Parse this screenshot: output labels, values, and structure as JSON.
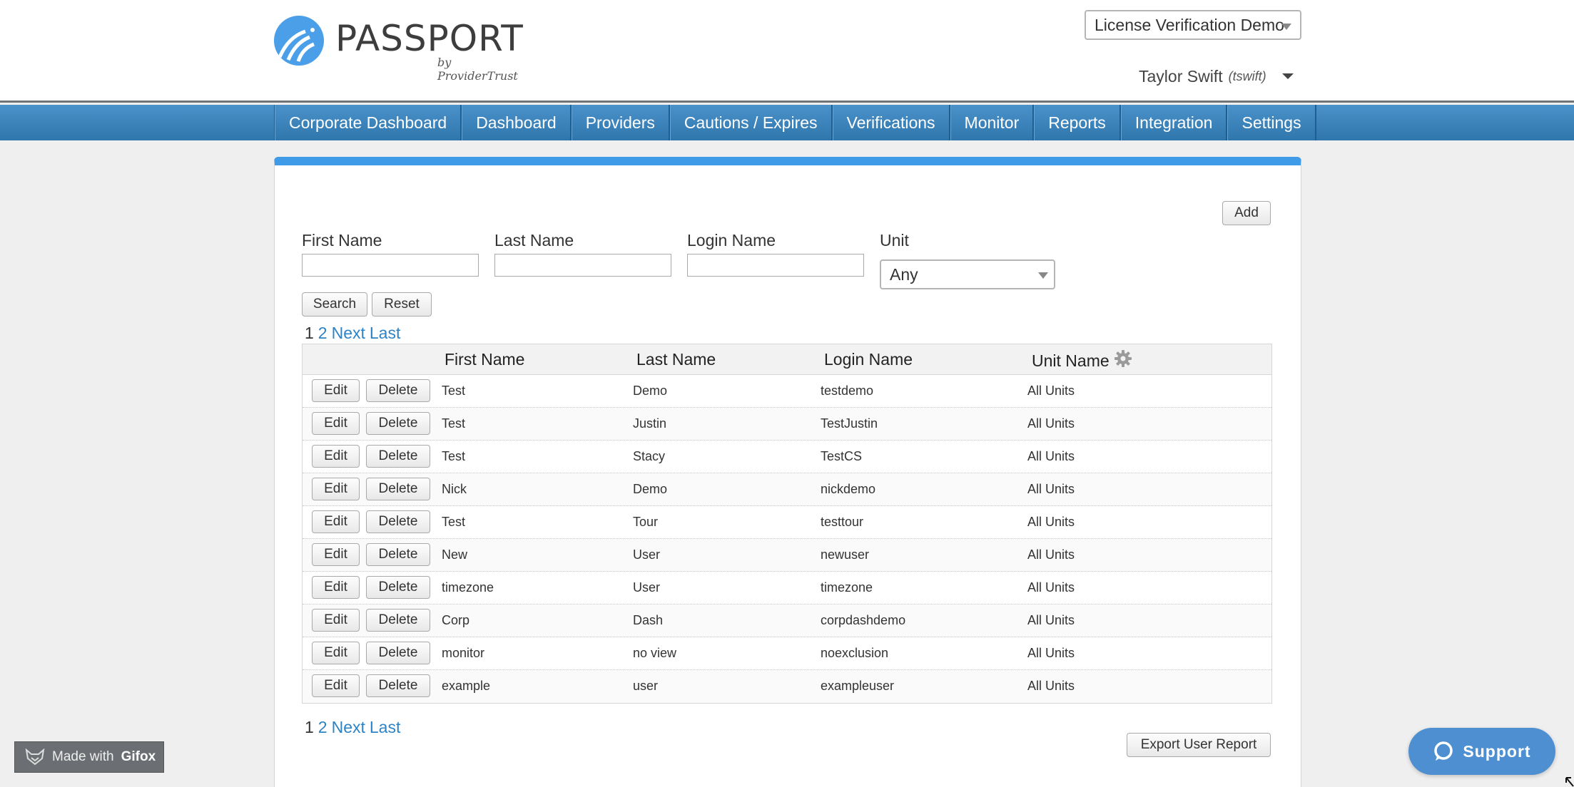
{
  "brand": {
    "name": "PASSPORT",
    "byline": "by ProviderTrust"
  },
  "account": {
    "selected": "License Verification Demo"
  },
  "user": {
    "display_name": "Taylor Swift",
    "login": "(tswift)"
  },
  "nav": {
    "items": [
      {
        "label": "Corporate Dashboard"
      },
      {
        "label": "Dashboard"
      },
      {
        "label": "Providers"
      },
      {
        "label": "Cautions / Expires"
      },
      {
        "label": "Verifications"
      },
      {
        "label": "Monitor"
      },
      {
        "label": "Reports"
      },
      {
        "label": "Integration"
      },
      {
        "label": "Settings"
      }
    ]
  },
  "toolbar": {
    "add_label": "Add",
    "search_label": "Search",
    "reset_label": "Reset",
    "export_label": "Export User Report"
  },
  "filters": {
    "first_name_label": "First Name",
    "first_name_value": "",
    "last_name_label": "Last Name",
    "last_name_value": "",
    "login_name_label": "Login Name",
    "login_name_value": "",
    "unit_label": "Unit",
    "unit_selected": "Any"
  },
  "pager": {
    "current": "1",
    "page2": "2",
    "next": "Next",
    "last": "Last"
  },
  "table": {
    "columns": {
      "first_name": "First Name",
      "last_name": "Last Name",
      "login_name": "Login Name",
      "unit_name": "Unit Name"
    },
    "edit_label": "Edit",
    "delete_label": "Delete",
    "rows": [
      {
        "first": "Test",
        "last": "Demo",
        "login": "testdemo",
        "unit": "All Units"
      },
      {
        "first": "Test",
        "last": "Justin",
        "login": "TestJustin",
        "unit": "All Units"
      },
      {
        "first": "Test",
        "last": "Stacy",
        "login": "TestCS",
        "unit": "All Units"
      },
      {
        "first": "Nick",
        "last": "Demo",
        "login": "nickdemo",
        "unit": "All Units"
      },
      {
        "first": "Test",
        "last": "Tour",
        "login": "testtour",
        "unit": "All Units"
      },
      {
        "first": "New",
        "last": "User",
        "login": "newuser",
        "unit": "All Units"
      },
      {
        "first": "timezone",
        "last": "User",
        "login": "timezone",
        "unit": "All Units"
      },
      {
        "first": "Corp",
        "last": "Dash",
        "login": "corpdashdemo",
        "unit": "All Units"
      },
      {
        "first": "monitor",
        "last": "no view",
        "login": "noexclusion",
        "unit": "All Units"
      },
      {
        "first": "example",
        "last": "user",
        "login": "exampleuser",
        "unit": "All Units"
      }
    ]
  },
  "watermark": {
    "prefix": "Made with",
    "brand": "Gifox"
  },
  "support": {
    "label": "Support"
  },
  "colors": {
    "accent": "#3f9ae8",
    "nav_blue": "#2f76ad",
    "link": "#2e83c5",
    "support": "#4d8fd0"
  },
  "icons": {
    "settings": "gear-icon",
    "support": "chat-bubble-icon",
    "watermark": "fox-icon"
  }
}
